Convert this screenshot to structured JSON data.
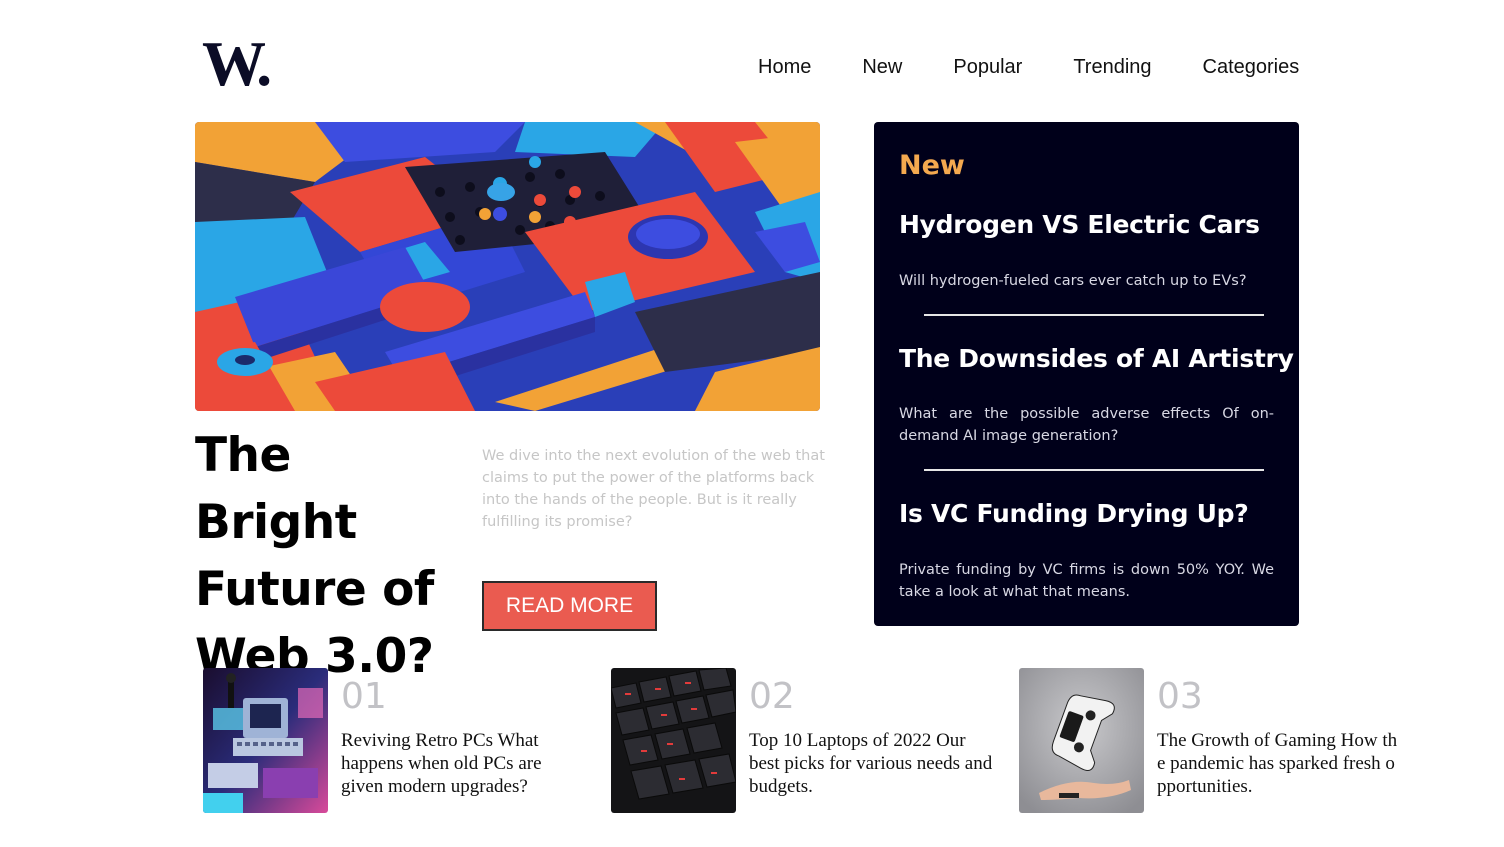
{
  "header": {
    "logo": "W.",
    "nav": [
      "Home",
      "New",
      "Popular",
      "Trending",
      "Categories"
    ]
  },
  "hero": {
    "title": "The Bright Future of Web 3.0?",
    "description": "We dive into the next evolution of the web that claims to put the power of the platforms back into the hands of the people. But is it really fulfilling its promise?",
    "button_label": "READ MORE"
  },
  "new_panel": {
    "heading": "New",
    "items": [
      {
        "title": "Hydrogen VS Electric Cars",
        "description": "Will hydrogen-fueled cars ever catch up to EVs?"
      },
      {
        "title": "The Downsides of AI Artistry",
        "description": "What are the possible adverse effects Of on-demand AI image generation?"
      },
      {
        "title": "Is VC Funding Drying Up?",
        "description": "Private funding by VC firms is down 50% YOY. We take a look at what that means."
      }
    ]
  },
  "cards": [
    {
      "number": "01",
      "title": "Reviving Retro PCs",
      "description": "What happens when old PCs are given modern upgrades?"
    },
    {
      "number": "02",
      "title": "Top 10 Laptops of 2022",
      "description": "Our best picks for various needs and budgets."
    },
    {
      "number": "03",
      "title": "The Growth of Gaming",
      "description": "How the pandemic has sparked fresh opportunities."
    }
  ],
  "colors": {
    "accent": "#ea5b50",
    "panel_bg": "#00001a",
    "panel_heading": "#f4a94f",
    "logo": "#0b0c26"
  }
}
